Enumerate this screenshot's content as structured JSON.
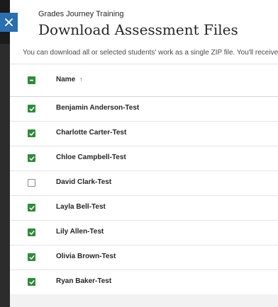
{
  "course": {
    "name": "Grades Journey Training"
  },
  "panel": {
    "title": "Download Assessment Files",
    "intro": "You can download all or selected students' work as a single ZIP file. You'll receive a",
    "close_icon": "close-icon"
  },
  "table": {
    "select_all_state": "mixed",
    "column_name": "Name",
    "sort_indicator": "↑",
    "sort_direction": "ascending",
    "rows": [
      {
        "name": "Benjamin Anderson-Test",
        "checked": true
      },
      {
        "name": "Charlotte Carter-Test",
        "checked": true
      },
      {
        "name": "Chloe Campbell-Test",
        "checked": true
      },
      {
        "name": "David Clark-Test",
        "checked": false
      },
      {
        "name": "Layla Bell-Test",
        "checked": true
      },
      {
        "name": "Lily Allen-Test",
        "checked": true
      },
      {
        "name": "Olivia Brown-Test",
        "checked": true
      },
      {
        "name": "Ryan Baker-Test",
        "checked": true
      }
    ]
  },
  "colors": {
    "accent_blue": "#2a6fb0",
    "check_green": "#2f8a3c",
    "sort_purple": "#7c2a90"
  }
}
